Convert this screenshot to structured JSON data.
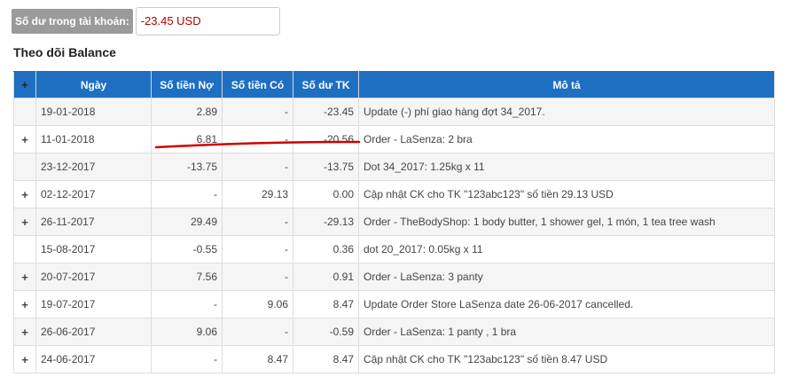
{
  "balance": {
    "label": "Số dư trong tài khoản:",
    "value": "-23.45 USD"
  },
  "section_title": "Theo dõi Balance",
  "table": {
    "headers": {
      "expand": "+",
      "date": "Ngày",
      "debit": "Số tiền Nợ",
      "credit": "Số tiền Có",
      "balance": "Số dư TK",
      "description": "Mô tả"
    },
    "rows": [
      {
        "expand": "",
        "date": "19-01-2018",
        "debit": "2.89",
        "credit": "-",
        "balance": "-23.45",
        "description": "Update (-) phí giao hàng đợt 34_2017."
      },
      {
        "expand": "+",
        "date": "11-01-2018",
        "debit": "6.81",
        "credit": "-",
        "balance": "-20.56",
        "description": "Order - LaSenza: 2 bra"
      },
      {
        "expand": "",
        "date": "23-12-2017",
        "debit": "-13.75",
        "credit": "-",
        "balance": "-13.75",
        "description": "Dot 34_2017: 1.25kg x 11"
      },
      {
        "expand": "+",
        "date": "02-12-2017",
        "debit": "-",
        "credit": "29.13",
        "balance": "0.00",
        "description": "Cập nhật CK cho TK \"123abc123\" số tiền 29.13 USD"
      },
      {
        "expand": "+",
        "date": "26-11-2017",
        "debit": "29.49",
        "credit": "-",
        "balance": "-29.13",
        "description": "Order - TheBodyShop: 1 body butter, 1 shower gel, 1 món, 1 tea tree wash"
      },
      {
        "expand": "",
        "date": "15-08-2017",
        "debit": "-0.55",
        "credit": "-",
        "balance": "0.36",
        "description": "dot 20_2017: 0.05kg x 11"
      },
      {
        "expand": "+",
        "date": "20-07-2017",
        "debit": "7.56",
        "credit": "-",
        "balance": "0.91",
        "description": "Order - LaSenza: 3 panty"
      },
      {
        "expand": "+",
        "date": "19-07-2017",
        "debit": "-",
        "credit": "9.06",
        "balance": "8.47",
        "description": "Update Order Store LaSenza date 26-06-2017 cancelled."
      },
      {
        "expand": "+",
        "date": "26-06-2017",
        "debit": "9.06",
        "credit": "-",
        "balance": "-0.59",
        "description": "Order - LaSenza: 1 panty , 1 bra"
      },
      {
        "expand": "+",
        "date": "24-06-2017",
        "debit": "-",
        "credit": "8.47",
        "balance": "8.47",
        "description": "Cập nhật CK cho TK \"123abc123\" số tiền 8.47 USD"
      }
    ]
  },
  "colors": {
    "header_bg": "#1e6fc2",
    "balance_value": "#b00000",
    "annotation": "#d00000"
  }
}
